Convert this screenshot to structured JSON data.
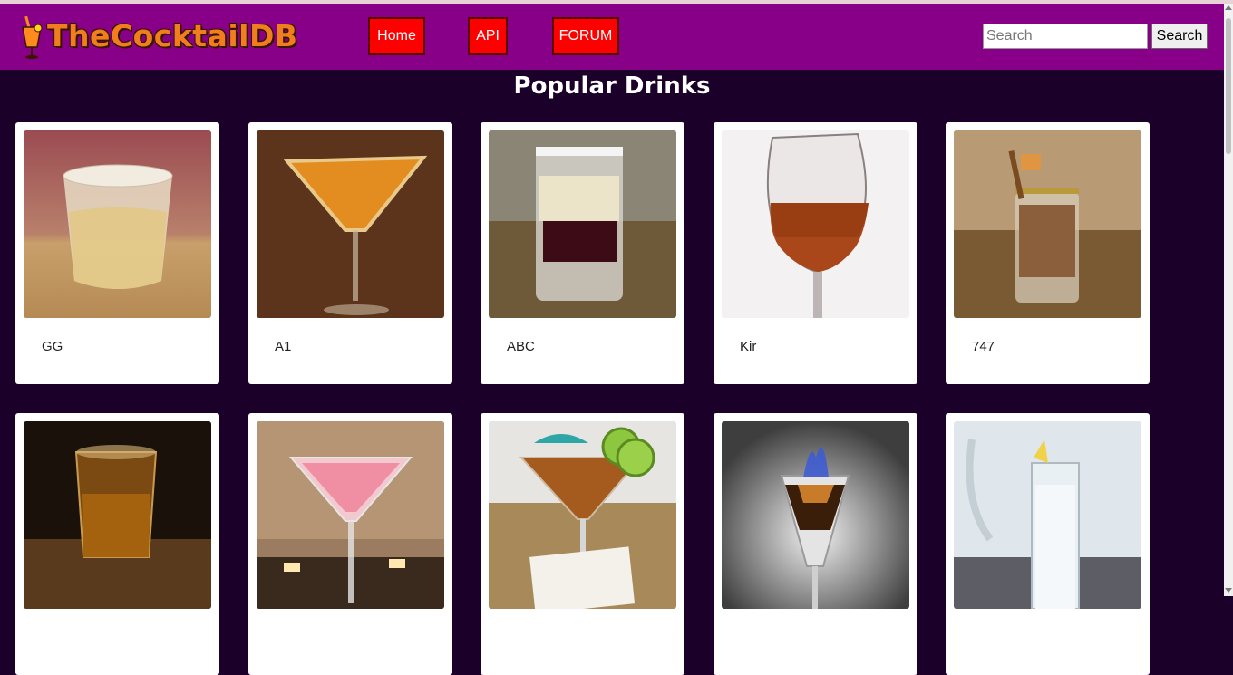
{
  "header": {
    "logo_text": "TheCocktailDB",
    "nav": {
      "home": "Home",
      "api": "API",
      "forum": "FORUM"
    },
    "search": {
      "placeholder": "Search",
      "button": "Search"
    }
  },
  "main": {
    "title": "Popular Drinks",
    "drinks": [
      {
        "name": "GG"
      },
      {
        "name": "A1"
      },
      {
        "name": "ABC"
      },
      {
        "name": "Kir"
      },
      {
        "name": "747"
      },
      {
        "name": ""
      },
      {
        "name": ""
      },
      {
        "name": ""
      },
      {
        "name": ""
      },
      {
        "name": ""
      }
    ]
  },
  "colors": {
    "header_bg": "#880088",
    "page_bg": "#1b0029",
    "nav_button": "#ff0000",
    "logo_text": "#f07d1e"
  }
}
